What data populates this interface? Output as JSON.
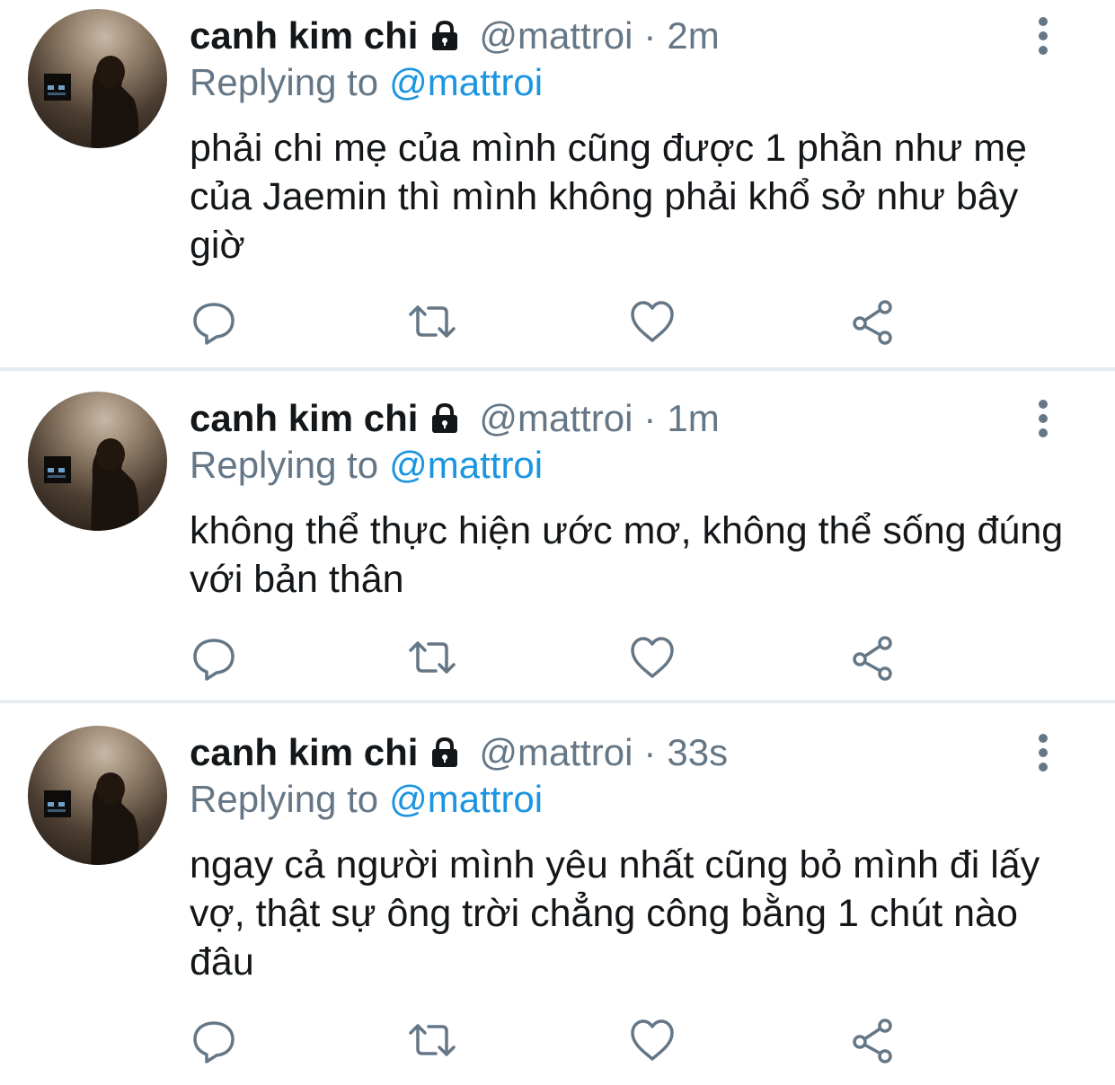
{
  "colors": {
    "text": "#14171a",
    "secondary": "#657786",
    "mention": "#1b95e0",
    "divider": "#e6ecf0"
  },
  "tweets": [
    {
      "name": "canh kim chi",
      "handle": "@mattroi",
      "separator": "·",
      "time": "2m",
      "replying_label": "Replying to",
      "replying_to": "@mattroi",
      "text": "phải chi mẹ của mình cũng được 1 phần như mẹ của Jaemin thì mình không phải khổ sở như bây giờ",
      "icons": [
        "lock-icon",
        "more-vertical-icon",
        "reply-icon",
        "retweet-icon",
        "like-icon",
        "share-icon"
      ]
    },
    {
      "name": "canh kim chi",
      "handle": "@mattroi",
      "separator": "·",
      "time": "1m",
      "replying_label": "Replying to",
      "replying_to": "@mattroi",
      "text": "không thể thực hiện ước mơ, không thể sống đúng với bản thân",
      "icons": [
        "lock-icon",
        "more-vertical-icon",
        "reply-icon",
        "retweet-icon",
        "like-icon",
        "share-icon"
      ]
    },
    {
      "name": "canh kim chi",
      "handle": "@mattroi",
      "separator": "·",
      "time": "33s",
      "replying_label": "Replying to",
      "replying_to": "@mattroi",
      "text": "ngay cả người mình yêu nhất cũng bỏ mình đi lấy vợ, thật sự ông trời chẳng công bằng 1 chút nào đâu",
      "icons": [
        "lock-icon",
        "more-vertical-icon",
        "reply-icon",
        "retweet-icon",
        "like-icon",
        "share-icon"
      ]
    }
  ]
}
